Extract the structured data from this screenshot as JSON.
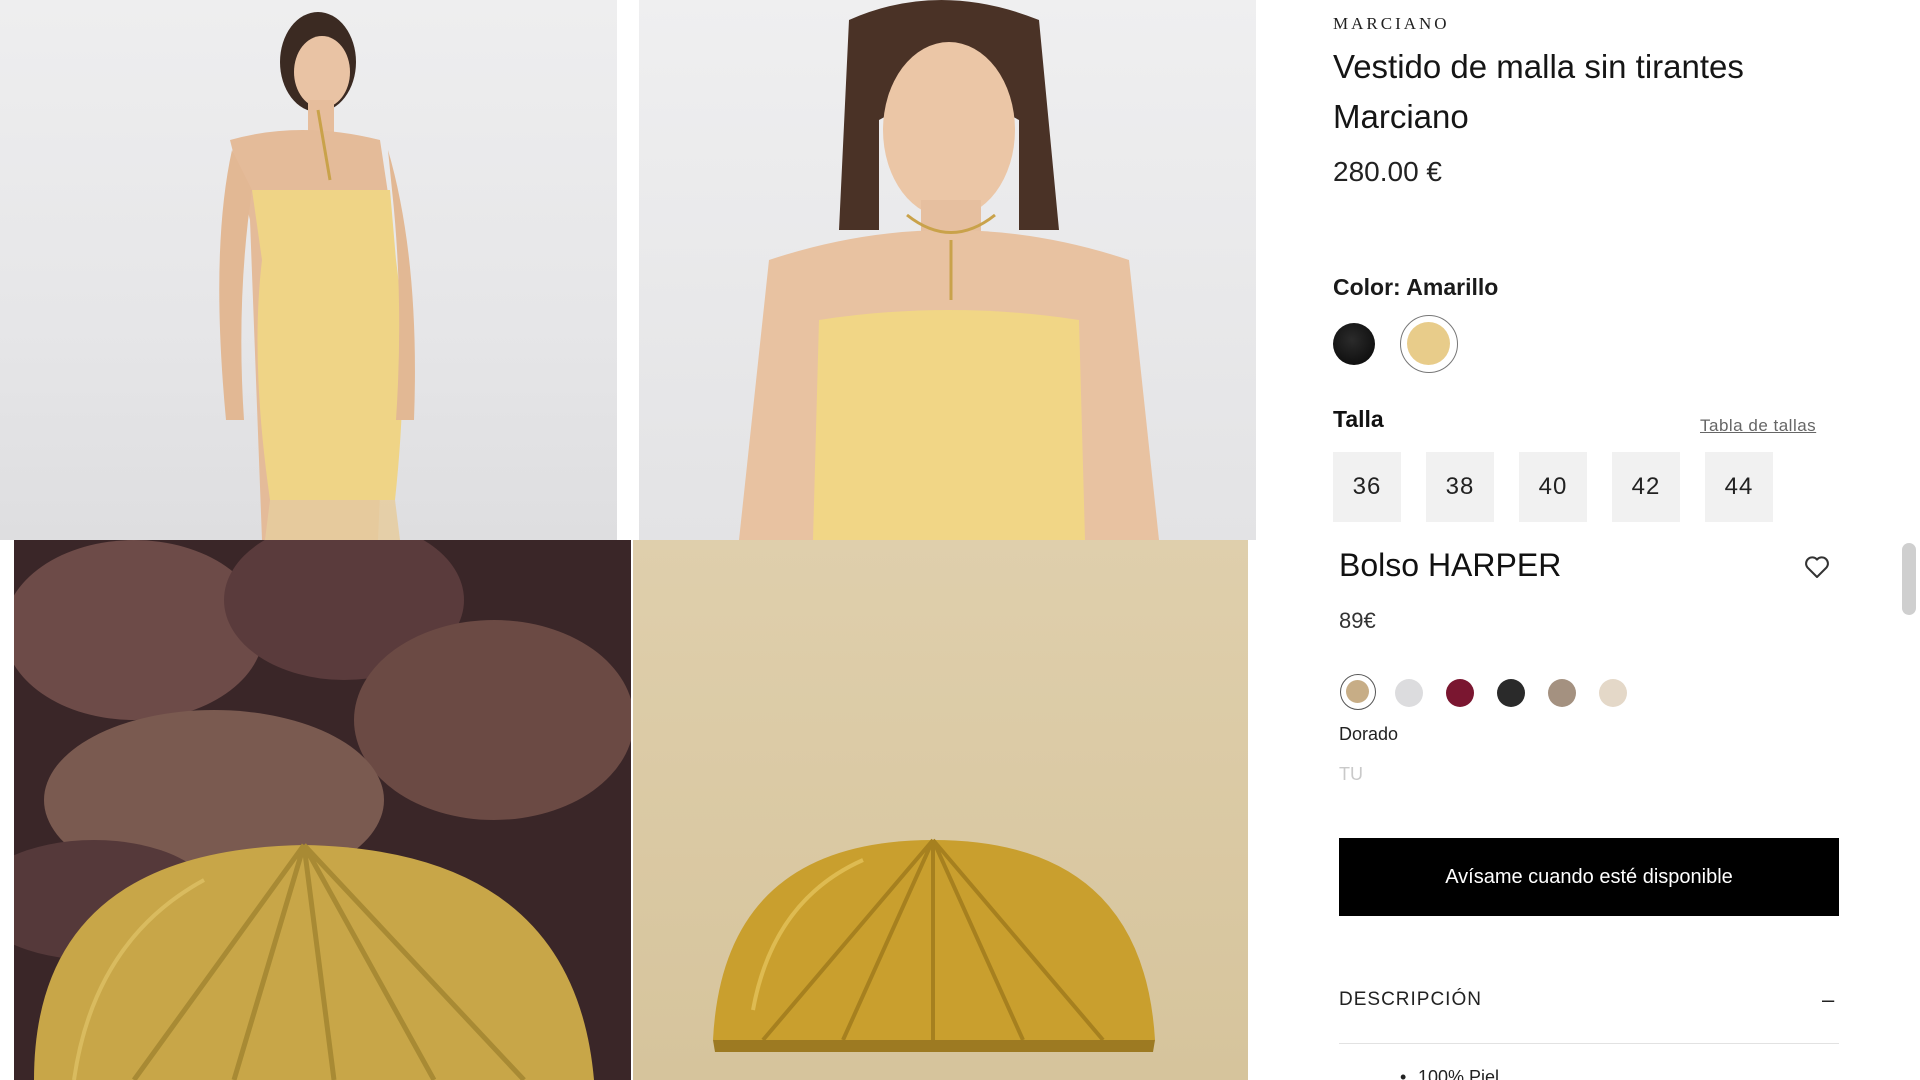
{
  "product": {
    "brand": "MARCIANO",
    "title": "Vestido de malla sin tirantes Marciano",
    "price": "280.00 €",
    "color_label": "Color:",
    "color_value": "Amarillo",
    "colors": [
      {
        "name": "black",
        "hex": "#151515",
        "selected": false
      },
      {
        "name": "yellow",
        "hex": "#e8cc8a",
        "selected": true
      }
    ],
    "size_label": "Talla",
    "size_guide": "Tabla de tallas",
    "sizes": [
      "36",
      "38",
      "40",
      "42",
      "44"
    ]
  },
  "bag": {
    "title": "Bolso HARPER",
    "price": "89€",
    "colors": [
      {
        "hex": "#c7ad86",
        "selected": true
      },
      {
        "hex": "#dcdcde",
        "selected": false
      },
      {
        "hex": "#7a1630",
        "selected": false
      },
      {
        "hex": "#2a2a2a",
        "selected": false
      },
      {
        "hex": "#a49180",
        "selected": false
      },
      {
        "hex": "#e4d8c8",
        "selected": false
      }
    ],
    "selected_color_name": "Dorado",
    "size": "TU",
    "notify_button": "Avísame cuando esté disponible",
    "description_header": "DESCRIPCIÓN",
    "description_toggle": "–",
    "description_items": [
      "100% Piel"
    ]
  },
  "icons": {
    "heart": "heart-icon"
  }
}
